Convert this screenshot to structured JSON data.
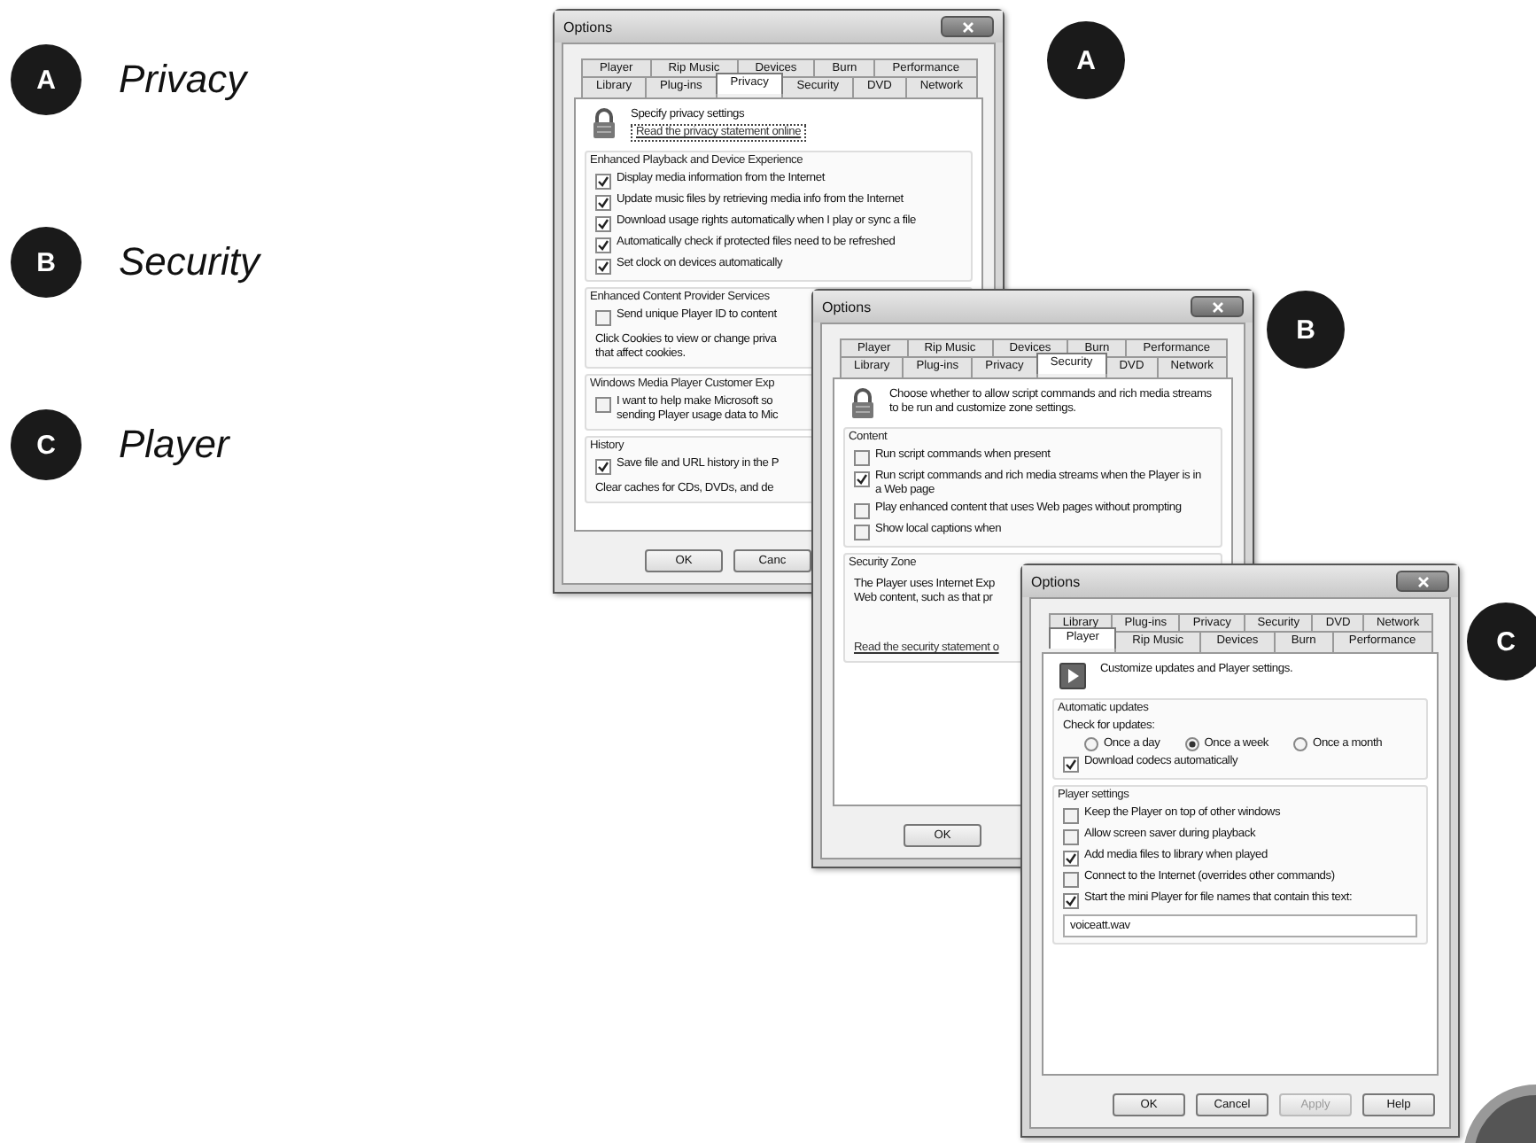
{
  "legend": [
    {
      "badge": "A",
      "label": "Privacy"
    },
    {
      "badge": "B",
      "label": "Security"
    },
    {
      "badge": "C",
      "label": "Player"
    }
  ],
  "windows": [
    {
      "callout": "A",
      "title": "Options",
      "tab_rows": [
        [
          {
            "label": "Player",
            "selected": false
          },
          {
            "label": "Rip Music",
            "selected": false
          },
          {
            "label": "Devices",
            "selected": false
          },
          {
            "label": "Burn",
            "selected": false
          },
          {
            "label": "Performance",
            "selected": false
          }
        ],
        [
          {
            "label": "Library",
            "selected": false
          },
          {
            "label": "Plug-ins",
            "selected": false
          },
          {
            "label": "Privacy",
            "selected": true
          },
          {
            "label": "Security",
            "selected": false
          },
          {
            "label": "DVD",
            "selected": false
          },
          {
            "label": "Network",
            "selected": false
          }
        ]
      ],
      "header": {
        "text": "Specify privacy settings",
        "link": "Read the privacy statement online"
      },
      "groups": [
        {
          "title": "Enhanced Playback and Device Experience",
          "items": [
            {
              "kind": "checkbox",
              "label": "Display media information from the Internet",
              "checked": true
            },
            {
              "kind": "checkbox",
              "label": "Update music files by retrieving media info from the Internet",
              "checked": true
            },
            {
              "kind": "checkbox",
              "label": "Download usage rights automatically when I play or sync a file",
              "checked": true
            },
            {
              "kind": "checkbox",
              "label": "Automatically check if protected files need to be refreshed",
              "checked": true
            },
            {
              "kind": "checkbox",
              "label": "Set clock on devices automatically",
              "checked": true
            }
          ]
        },
        {
          "title": "Enhanced Content Provider Services",
          "items": [
            {
              "kind": "checkbox",
              "label": "Send unique Player ID to content",
              "checked": false
            },
            {
              "kind": "text",
              "lines": [
                "Click Cookies to view or change priva",
                "that affect cookies."
              ]
            }
          ]
        },
        {
          "title": "Windows Media Player Customer Exp",
          "items": [
            {
              "kind": "checkbox",
              "lines": [
                "I want to help make Microsoft so",
                "sending Player usage data to Mic"
              ],
              "checked": false
            }
          ]
        },
        {
          "title": "History",
          "items": [
            {
              "kind": "checkbox",
              "label": "Save file and URL history in the P",
              "checked": true
            },
            {
              "kind": "text",
              "lines": [
                "Clear caches for CDs, DVDs, and de"
              ]
            }
          ]
        }
      ],
      "buttons": [
        {
          "label": "OK",
          "disabled": false
        },
        {
          "label": "Canc",
          "disabled": false
        }
      ]
    },
    {
      "callout": "B",
      "title": "Options",
      "tab_rows": [
        [
          {
            "label": "Player",
            "selected": false
          },
          {
            "label": "Rip Music",
            "selected": false
          },
          {
            "label": "Devices",
            "selected": false
          },
          {
            "label": "Burn",
            "selected": false
          },
          {
            "label": "Performance",
            "selected": false
          }
        ],
        [
          {
            "label": "Library",
            "selected": false
          },
          {
            "label": "Plug-ins",
            "selected": false
          },
          {
            "label": "Privacy",
            "selected": false
          },
          {
            "label": "Security",
            "selected": true
          },
          {
            "label": "DVD",
            "selected": false
          },
          {
            "label": "Network",
            "selected": false
          }
        ]
      ],
      "header": {
        "text": "Choose whether to allow script commands and rich media streams to be run and customize zone settings."
      },
      "groups": [
        {
          "title": "Content",
          "items": [
            {
              "kind": "checkbox",
              "label": "Run script commands when present",
              "checked": false
            },
            {
              "kind": "checkbox",
              "lines": [
                "Run script commands and rich media streams when the Player is in",
                "a Web page"
              ],
              "checked": true
            },
            {
              "kind": "checkbox",
              "label": "Play enhanced content that uses Web pages without prompting",
              "checked": false
            },
            {
              "kind": "checkbox",
              "label": "Show local captions when",
              "checked": false
            }
          ]
        },
        {
          "title": "Security Zone",
          "items": [
            {
              "kind": "text",
              "lines": [
                "The Player uses Internet Exp",
                "Web content, such as that pr"
              ]
            },
            {
              "kind": "link",
              "label": "Read the security statement o"
            }
          ]
        }
      ],
      "buttons": [
        {
          "label": "OK",
          "disabled": false
        }
      ]
    },
    {
      "callout": "C",
      "title": "Options",
      "tab_rows": [
        [
          {
            "label": "Library",
            "selected": false
          },
          {
            "label": "Plug-ins",
            "selected": false
          },
          {
            "label": "Privacy",
            "selected": false
          },
          {
            "label": "Security",
            "selected": false
          },
          {
            "label": "DVD",
            "selected": false
          },
          {
            "label": "Network",
            "selected": false
          }
        ],
        [
          {
            "label": "Player",
            "selected": true
          },
          {
            "label": "Rip Music",
            "selected": false
          },
          {
            "label": "Devices",
            "selected": false
          },
          {
            "label": "Burn",
            "selected": false
          },
          {
            "label": "Performance",
            "selected": false
          }
        ]
      ],
      "header": {
        "text": "Customize updates and Player settings."
      },
      "groups": [
        {
          "title": "Automatic updates",
          "items": [
            {
              "kind": "label",
              "label": "Check for updates:"
            },
            {
              "kind": "radios",
              "options": [
                {
                  "label": "Once a day",
                  "selected": false
                },
                {
                  "label": "Once a week",
                  "selected": true
                },
                {
                  "label": "Once a month",
                  "selected": false
                }
              ]
            },
            {
              "kind": "checkbox",
              "label": "Download codecs automatically",
              "checked": true
            }
          ]
        },
        {
          "title": "Player settings",
          "items": [
            {
              "kind": "checkbox",
              "label": "Keep the Player on top of other windows",
              "checked": false
            },
            {
              "kind": "checkbox",
              "label": "Allow screen saver during playback",
              "checked": false
            },
            {
              "kind": "checkbox",
              "label": "Add media files to library when played",
              "checked": true
            },
            {
              "kind": "checkbox",
              "label": "Connect to the Internet (overrides other commands)",
              "checked": false
            },
            {
              "kind": "checkbox",
              "label": "Start the mini Player for file names that contain this text:",
              "checked": true
            },
            {
              "kind": "field",
              "value": "voiceatt.wav"
            }
          ]
        }
      ],
      "buttons": [
        {
          "label": "OK",
          "disabled": false
        },
        {
          "label": "Cancel",
          "disabled": false
        },
        {
          "label": "Apply",
          "disabled": true
        },
        {
          "label": "Help",
          "disabled": false
        }
      ]
    }
  ]
}
